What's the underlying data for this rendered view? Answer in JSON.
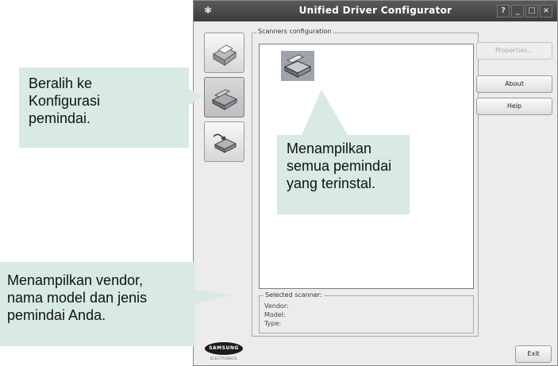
{
  "window": {
    "title": "Unified Driver Configurator",
    "controls": [
      "?",
      "_",
      "□",
      "×"
    ]
  },
  "nav": {
    "items": [
      {
        "name": "printers",
        "icon": "printer-icon"
      },
      {
        "name": "scanners",
        "icon": "scanner-icon",
        "active": true
      },
      {
        "name": "ports",
        "icon": "port-icon"
      }
    ]
  },
  "scanners": {
    "group_title": "Scanners configuration",
    "selected_title": "Selected scanner:",
    "vendor_label": "Vendor:",
    "model_label": "Model:",
    "type_label": "Type:"
  },
  "buttons": {
    "properties": "Properties...",
    "about": "About",
    "help": "Help",
    "exit": "Exit"
  },
  "logo": {
    "brand": "SAMSUNG",
    "sub": "ELECTRONICS"
  },
  "callouts": {
    "nav": [
      "Beralih ke",
      "Konfigurasi",
      "pemindai."
    ],
    "list": [
      "Menampilkan",
      "semua pemindai",
      "yang terinstal."
    ],
    "selected": [
      "Menampilkan vendor,",
      "nama model dan jenis",
      "pemindai Anda."
    ]
  },
  "colors": {
    "callout_bg": "#d8e9e6",
    "titlebar": "#454545",
    "window_bg": "#ececec"
  }
}
